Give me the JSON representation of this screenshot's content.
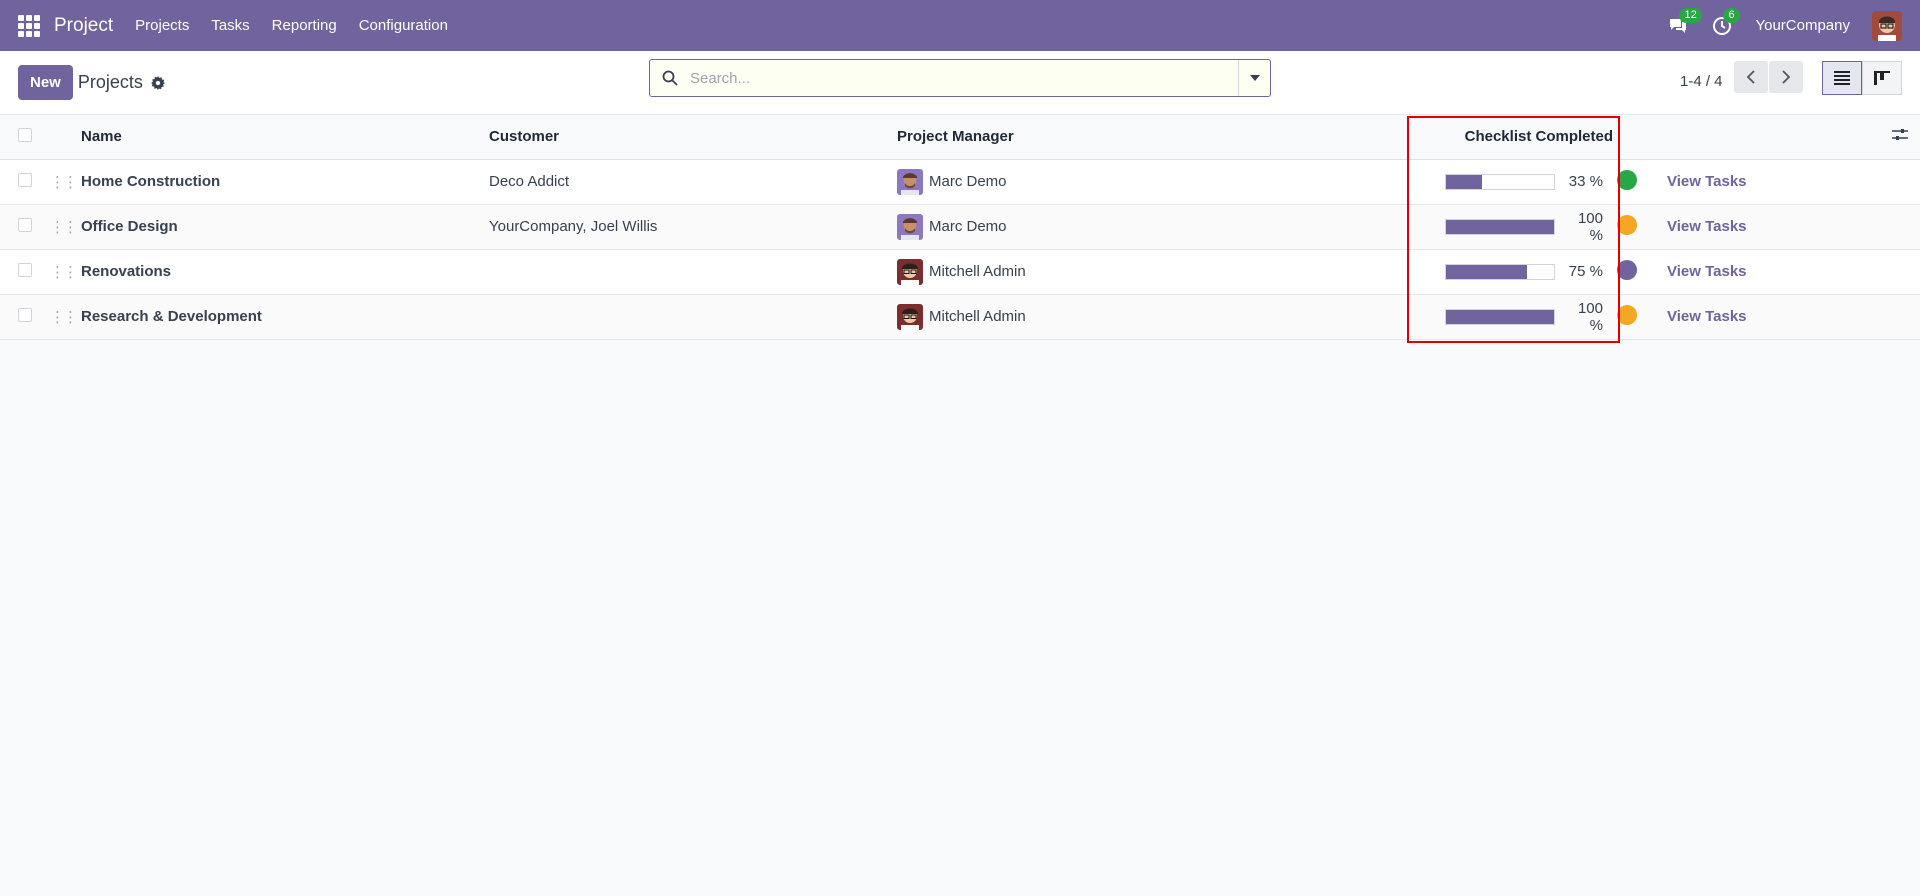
{
  "navbar": {
    "app_name": "Project",
    "menu": [
      "Projects",
      "Tasks",
      "Reporting",
      "Configuration"
    ],
    "messages_count": "12",
    "activities_count": "6",
    "company": "YourCompany"
  },
  "control": {
    "new_label": "New",
    "breadcrumb": "Projects",
    "search_placeholder": "Search...",
    "pager": "1-4 / 4"
  },
  "table": {
    "headers": {
      "name": "Name",
      "customer": "Customer",
      "manager": "Project Manager",
      "checklist": "Checklist Completed"
    },
    "rows": [
      {
        "name": "Home Construction",
        "customer": "Deco Addict",
        "manager": "Marc Demo",
        "progress": 33,
        "progress_label": "33 %",
        "status_color": "#28a745",
        "action": "View Tasks"
      },
      {
        "name": "Office Design",
        "customer": "YourCompany, Joel Willis",
        "manager": "Marc Demo",
        "progress": 100,
        "progress_label": "100 %",
        "status_color": "#f5a623",
        "action": "View Tasks"
      },
      {
        "name": "Renovations",
        "customer": "",
        "manager": "Mitchell Admin",
        "progress": 75,
        "progress_label": "75 %",
        "status_color": "#71639e",
        "action": "View Tasks"
      },
      {
        "name": "Research & Development",
        "customer": "",
        "manager": "Mitchell Admin",
        "progress": 100,
        "progress_label": "100 %",
        "status_color": "#f5a623",
        "action": "View Tasks"
      }
    ]
  },
  "colors": {
    "brand": "#71639e",
    "highlight": "#e00000"
  }
}
